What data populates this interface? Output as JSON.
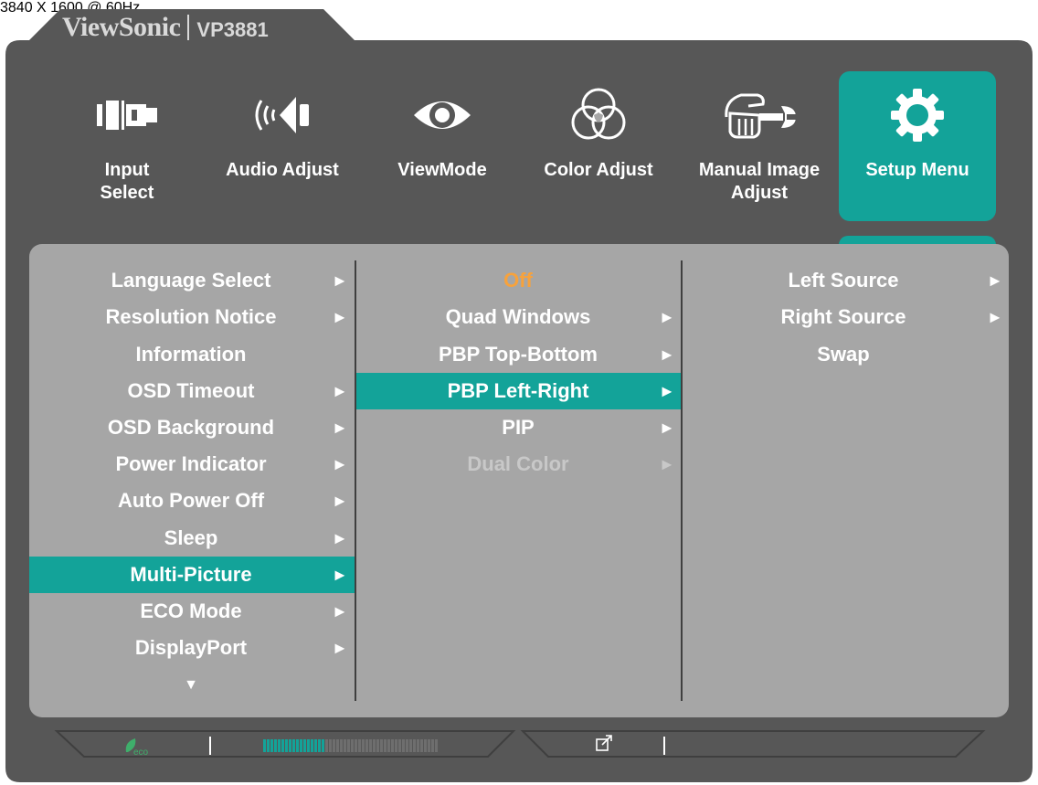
{
  "brand": {
    "name": "ViewSonic",
    "model": "VP3881"
  },
  "colors": {
    "accent": "#13a399",
    "frame": "#575757",
    "panel": "#a6a6a6",
    "highlight_text": "#f7a23c",
    "disabled_text": "#c8c8c8"
  },
  "categories": [
    {
      "label": "Input\nSelect",
      "icon": "input-select-icon",
      "active": false
    },
    {
      "label": "Audio Adjust",
      "icon": "speaker-icon",
      "active": false
    },
    {
      "label": "ViewMode",
      "icon": "eye-icon",
      "active": false
    },
    {
      "label": "Color Adjust",
      "icon": "color-circles-icon",
      "active": false
    },
    {
      "label": "Manual Image\nAdjust",
      "icon": "hand-wrench-icon",
      "active": false
    },
    {
      "label": "Setup Menu",
      "icon": "gear-icon",
      "active": true
    }
  ],
  "menu1": {
    "items": [
      {
        "label": "Language Select",
        "arrow": "►"
      },
      {
        "label": "Resolution Notice",
        "arrow": "►"
      },
      {
        "label": "Information",
        "arrow": ""
      },
      {
        "label": "OSD Timeout",
        "arrow": "►"
      },
      {
        "label": "OSD Background",
        "arrow": "►"
      },
      {
        "label": "Power Indicator",
        "arrow": "►"
      },
      {
        "label": "Auto Power Off",
        "arrow": "►"
      },
      {
        "label": "Sleep",
        "arrow": "►"
      },
      {
        "label": "Multi-Picture",
        "arrow": "►"
      },
      {
        "label": "ECO Mode",
        "arrow": "►"
      },
      {
        "label": "DisplayPort",
        "arrow": "►"
      }
    ],
    "selected_index": 8,
    "more_indicator": "▼"
  },
  "menu2": {
    "items": [
      {
        "label": "Off",
        "arrow": ""
      },
      {
        "label": "Quad Windows",
        "arrow": "►"
      },
      {
        "label": "PBP Top-Bottom",
        "arrow": "►"
      },
      {
        "label": "PBP Left-Right",
        "arrow": "►"
      },
      {
        "label": "PIP",
        "arrow": "►"
      },
      {
        "label": "Dual Color",
        "arrow": "►"
      }
    ],
    "selected_index": 3,
    "current_value_index": 0,
    "disabled_index": 5
  },
  "menu3": {
    "items": [
      {
        "label": "Left Source",
        "arrow": "►"
      },
      {
        "label": "Right Source",
        "arrow": "►"
      },
      {
        "label": "Swap",
        "arrow": ""
      }
    ]
  },
  "status": {
    "eco_label": "eco",
    "eco_icon": "eco-leaf-icon",
    "brightness_level": 0.36,
    "signal_icon": "external-link-icon",
    "resolution": "3840 X 1600 @ 60Hz"
  }
}
